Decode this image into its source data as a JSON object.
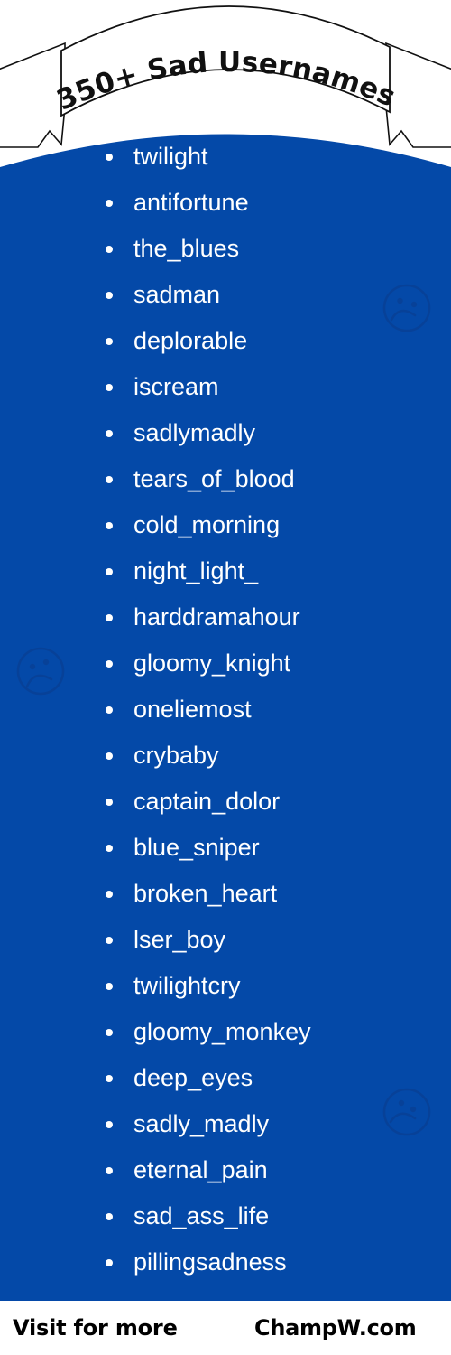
{
  "poster": {
    "title": "350+ Sad Usernames",
    "background_color": "#0449A8",
    "ribbon_color": "#FFFFFF",
    "text_color": "#FFFFFF",
    "title_color": "#111111"
  },
  "usernames": [
    "twilight",
    "antifortune",
    "the_blues",
    "sadman",
    "deplorable",
    "iscream",
    "sadlymadly",
    "tears_of_blood",
    "cold_morning",
    "night_light_",
    "harddramahour",
    "gloomy_knight",
    "oneliemost",
    "crybaby",
    "captain_dolor",
    "blue_sniper",
    "broken_heart",
    "lser_boy",
    "twilightcry",
    "gloomy_monkey",
    "deep_eyes",
    "sadly_madly",
    "eternal_pain",
    "sad_ass_life",
    "pillingsadness"
  ],
  "decorations": [
    {
      "name": "sad-face-icon-right-top"
    },
    {
      "name": "sad-face-icon-left-middle"
    },
    {
      "name": "sad-face-icon-right-bottom"
    }
  ],
  "footer": {
    "visit_label": "Visit for more",
    "site_label": "ChampW.com"
  }
}
